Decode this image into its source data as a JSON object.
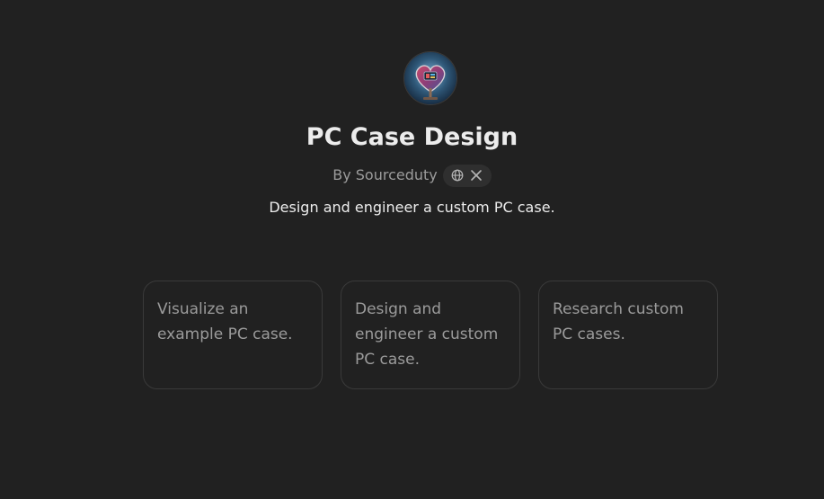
{
  "gpt": {
    "title": "PC Case Design",
    "byline": "By Sourceduty",
    "description": "Design and engineer a custom PC case."
  },
  "social": {
    "icons": [
      "globe-icon",
      "x-logo-icon"
    ]
  },
  "starters": [
    {
      "label": "Visualize an example PC case."
    },
    {
      "label": "Design and engineer a custom PC case."
    },
    {
      "label": "Research custom PC cases."
    }
  ],
  "colors": {
    "background": "#212121",
    "card_border": "#3a3a3a",
    "muted_text": "#9b9b9b",
    "primary_text": "#ececec"
  }
}
